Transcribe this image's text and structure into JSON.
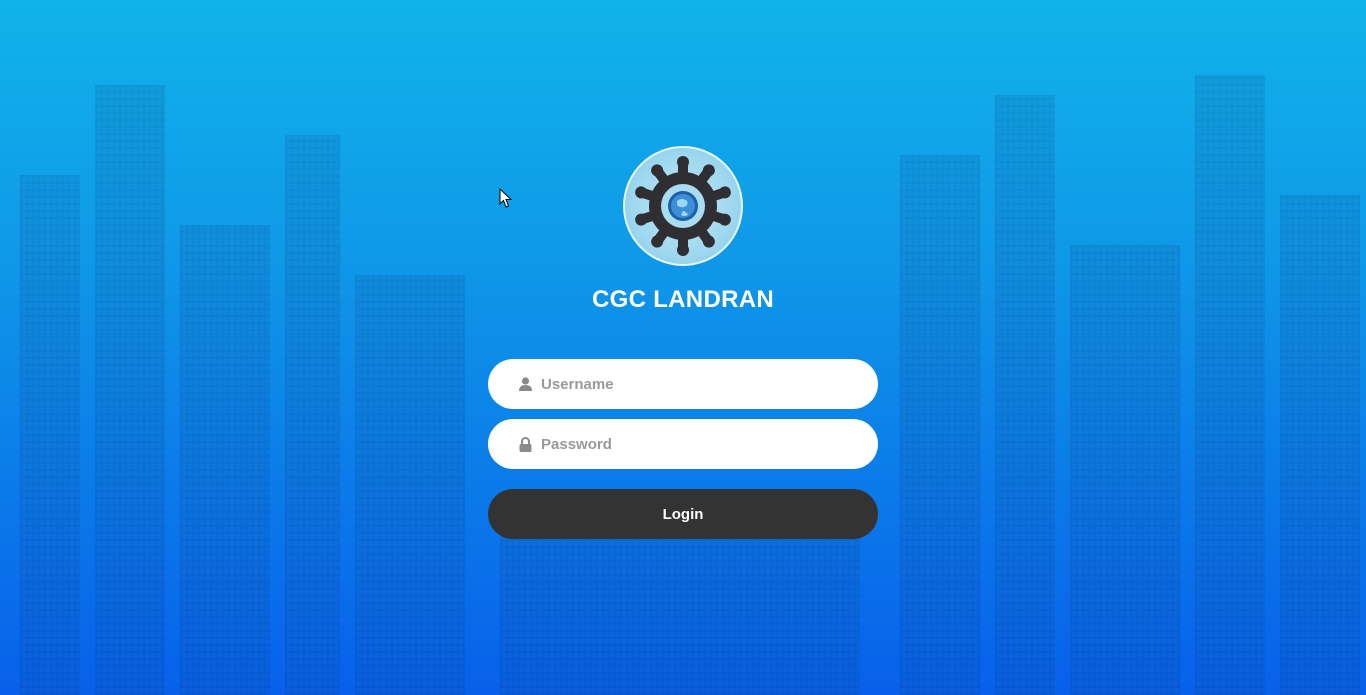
{
  "brand": {
    "title": "CGC LANDRAN",
    "logo_icon": "gear-globe-logo"
  },
  "form": {
    "username": {
      "placeholder": "Username",
      "value": "",
      "icon": "user-icon"
    },
    "password": {
      "placeholder": "Password",
      "value": "",
      "icon": "lock-icon"
    },
    "login_label": "Login"
  },
  "colors": {
    "background_top": "#10b3ea",
    "background_bottom": "#0860ea",
    "button": "#333333",
    "title": "#ffffff"
  }
}
